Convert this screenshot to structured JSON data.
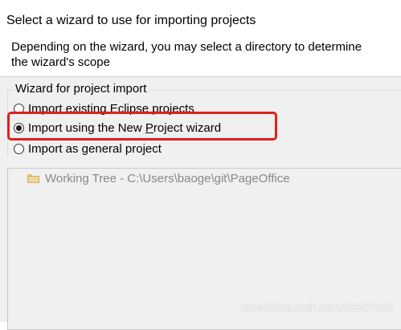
{
  "header": {
    "title": "Select a wizard to use for importing projects",
    "description": "Depending on the wizard, you may select a directory to determine\nthe wizard's scope"
  },
  "wizard_group": {
    "title": "Wizard for project import",
    "options": [
      {
        "pre": "Import existing Eclipse projects",
        "mnemonic": "",
        "post": "",
        "checked": false
      },
      {
        "pre": "Import using the New ",
        "mnemonic": "P",
        "post": "roject wizard",
        "checked": true
      },
      {
        "pre": "Import as general project",
        "mnemonic": "",
        "post": "",
        "checked": false
      }
    ]
  },
  "tree": {
    "items": [
      {
        "label": "Working Tree - C:\\Users\\baoge\\git\\PageOffice",
        "icon": "folder-icon"
      }
    ]
  },
  "watermark": "https://blog.csdn.net/u011471105",
  "colors": {
    "highlight": "#e0201a",
    "content_background": "#f0f0f0",
    "disabled_text": "#888888"
  }
}
